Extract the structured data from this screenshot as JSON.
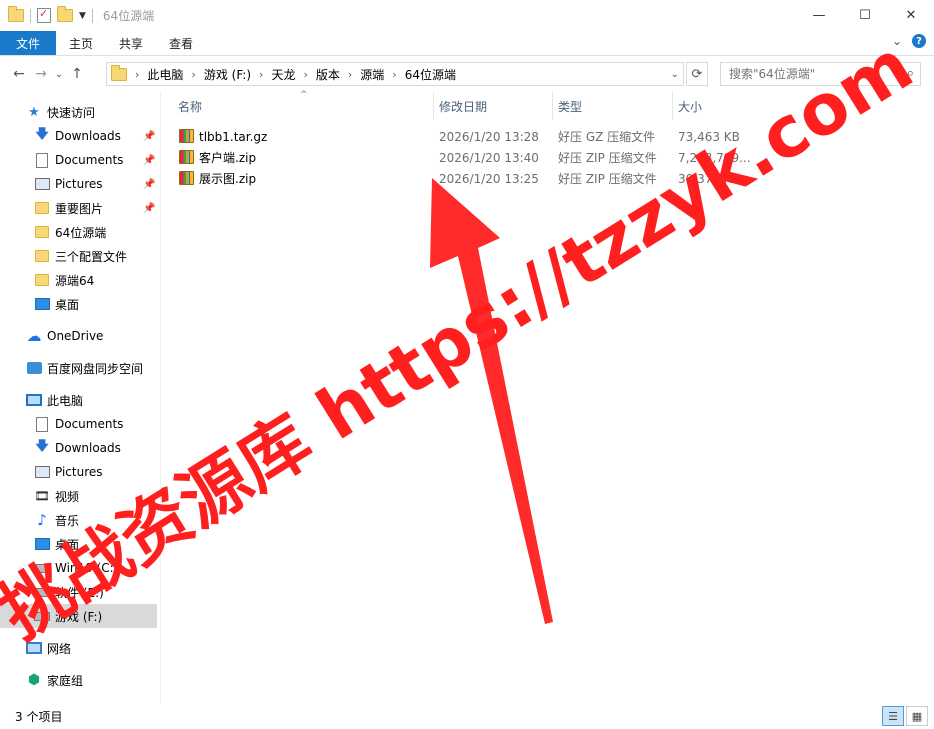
{
  "window": {
    "title": "64位源端",
    "controls": {
      "minimize": "—",
      "maximize": "☐",
      "close": "✕"
    }
  },
  "ribbon": {
    "tabs": [
      "文件",
      "主页",
      "共享",
      "查看"
    ],
    "expand_icon": "chevron-down-icon",
    "help_icon": "?"
  },
  "address": {
    "crumbs": [
      "此电脑",
      "游戏 (F:)",
      "天龙",
      "版本",
      "源端",
      "64位源端"
    ]
  },
  "search": {
    "placeholder": "搜索\"64位源端\""
  },
  "sidebar": {
    "quick_access": "快速访问",
    "items": [
      {
        "label": "Downloads",
        "icon": "download-icon",
        "pinned": true
      },
      {
        "label": "Documents",
        "icon": "document-icon",
        "pinned": true
      },
      {
        "label": "Pictures",
        "icon": "pictures-icon",
        "pinned": true
      },
      {
        "label": "重要图片",
        "icon": "folder-icon",
        "pinned": true
      },
      {
        "label": "64位源端",
        "icon": "folder-icon",
        "pinned": false
      },
      {
        "label": "三个配置文件",
        "icon": "folder-icon",
        "pinned": false
      },
      {
        "label": "源端64",
        "icon": "folder-icon",
        "pinned": false
      },
      {
        "label": "桌面",
        "icon": "desktop-icon",
        "pinned": false
      }
    ],
    "onedrive": "OneDrive",
    "baidu": "百度网盘同步空间",
    "this_pc": "此电脑",
    "pc_items": [
      {
        "label": "Documents",
        "icon": "document-icon"
      },
      {
        "label": "Downloads",
        "icon": "download-icon"
      },
      {
        "label": "Pictures",
        "icon": "pictures-icon"
      },
      {
        "label": "视频",
        "icon": "video-icon"
      },
      {
        "label": "音乐",
        "icon": "music-icon"
      },
      {
        "label": "桌面",
        "icon": "desktop-icon"
      },
      {
        "label": "Win10 (C:)",
        "icon": "drive-icon"
      },
      {
        "label": "软件 (E:)",
        "icon": "drive-icon"
      },
      {
        "label": "游戏 (F:)",
        "icon": "drive-icon",
        "selected": true
      }
    ],
    "network": "网络",
    "homegroup": "家庭组"
  },
  "columns": {
    "name": "名称",
    "date": "修改日期",
    "type": "类型",
    "size": "大小"
  },
  "files": [
    {
      "name": "tlbb1.tar.gz",
      "date": "2026/1/20 13:28",
      "type": "好压 GZ 压缩文件",
      "size": "73,463 KB"
    },
    {
      "name": "客户端.zip",
      "date": "2026/1/20 13:40",
      "type": "好压 ZIP 压缩文件",
      "size": "7,203,789..."
    },
    {
      "name": "展示图.zip",
      "date": "2026/1/20 13:25",
      "type": "好压 ZIP 压缩文件",
      "size": "30,374 KB"
    }
  ],
  "status": {
    "count": "3 个项目"
  },
  "watermark": {
    "text": "挑战资源库 https://tzzyk.com",
    "color": "#ff1f1f"
  }
}
